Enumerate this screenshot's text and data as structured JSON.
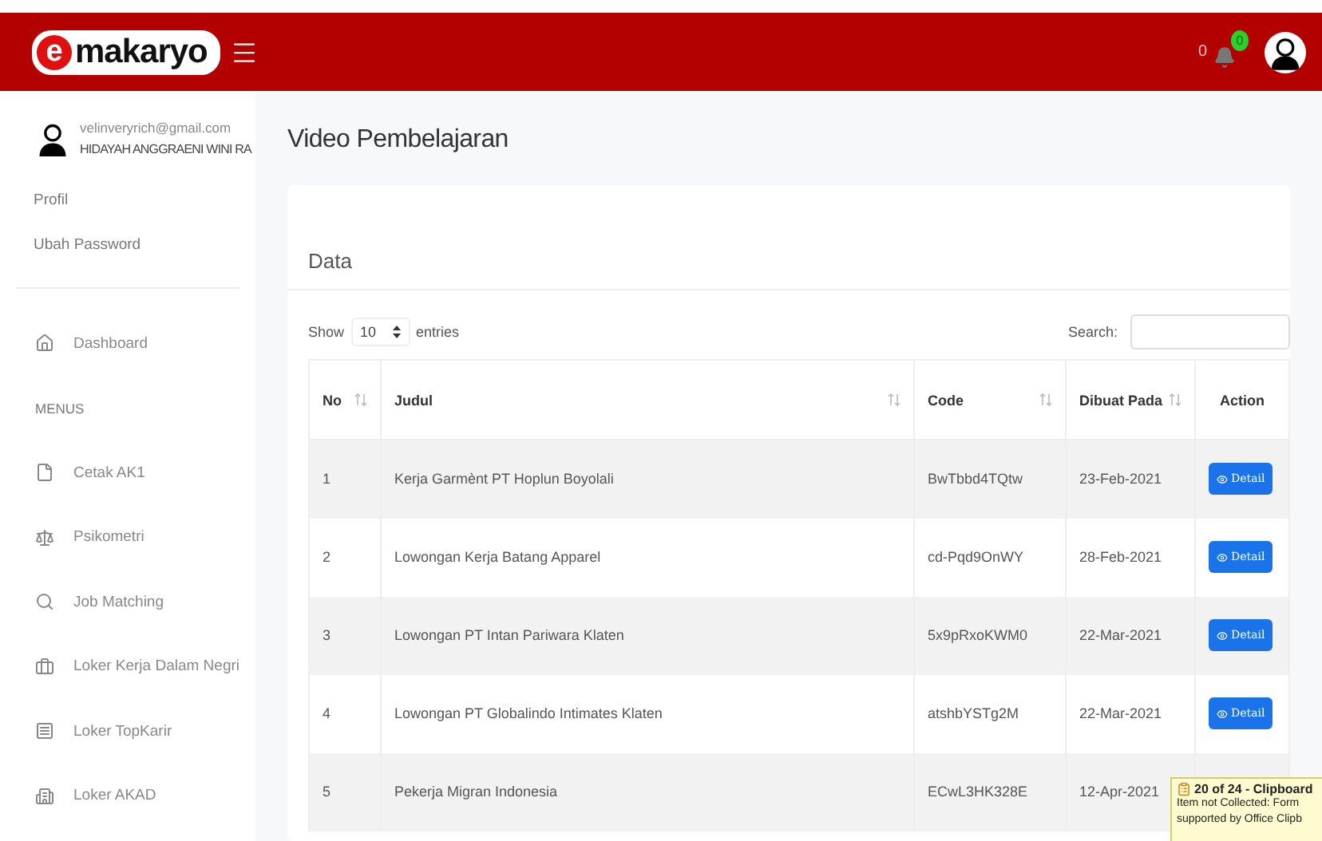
{
  "header": {
    "logo_mark": "e",
    "logo_text": "makaryo",
    "notification_count": "0",
    "bell_badge": "0"
  },
  "user": {
    "email": "velinveryrich@gmail.com",
    "name": "HIDAYAH ANGGRAENI WINI RA"
  },
  "account_links": [
    "Profil",
    "Ubah Password"
  ],
  "sidebar": {
    "items": [
      {
        "kind": "link",
        "label": "Dashboard"
      },
      {
        "kind": "heading",
        "label": "MENUS"
      },
      {
        "kind": "link",
        "label": "Cetak AK1"
      },
      {
        "kind": "link",
        "label": "Psikometri"
      },
      {
        "kind": "link",
        "label": "Job Matching"
      },
      {
        "kind": "link",
        "label": "Loker Kerja Dalam Negri"
      },
      {
        "kind": "link",
        "label": "Loker TopKarir"
      },
      {
        "kind": "link",
        "label": "Loker AKAD"
      }
    ]
  },
  "page_title": "Video Pembelajaran",
  "card": {
    "title": "Data",
    "show_label": "Show",
    "entries_value": "10",
    "entries_label": "entries",
    "search_label": "Search:"
  },
  "table": {
    "columns": [
      {
        "label": "No",
        "sortable": true
      },
      {
        "label": "Judul",
        "sortable": true
      },
      {
        "label": "Code",
        "sortable": true
      },
      {
        "label": "Dibuat Pada",
        "sortable": true
      },
      {
        "label": "Action",
        "sortable": false
      }
    ],
    "rows": [
      {
        "no": "1",
        "judul": "Kerja Garmènt PT Hoplun Boyolali",
        "code": "BwTbbd4TQtw",
        "date": "23-Feb-2021",
        "action": "Detail"
      },
      {
        "no": "2",
        "judul": "Lowongan Kerja Batang Apparel",
        "code": "cd-Pqd9OnWY",
        "date": "28-Feb-2021",
        "action": "Detail"
      },
      {
        "no": "3",
        "judul": "Lowongan PT Intan Pariwara Klaten",
        "code": "5x9pRxoKWM0",
        "date": "22-Mar-2021",
        "action": "Detail"
      },
      {
        "no": "4",
        "judul": "Lowongan PT Globalindo Intimates Klaten",
        "code": "atshbYSTg2M",
        "date": "22-Mar-2021",
        "action": "Detail"
      },
      {
        "no": "5",
        "judul": "Pekerja Migran Indonesia",
        "code": "ECwL3HK328E",
        "date": "12-Apr-2021"
      }
    ]
  },
  "clipboard_popup": {
    "title": "20 of 24 - Clipboard",
    "lines": [
      "Item not Collected: Form",
      "supported by Office Clipb"
    ]
  }
}
